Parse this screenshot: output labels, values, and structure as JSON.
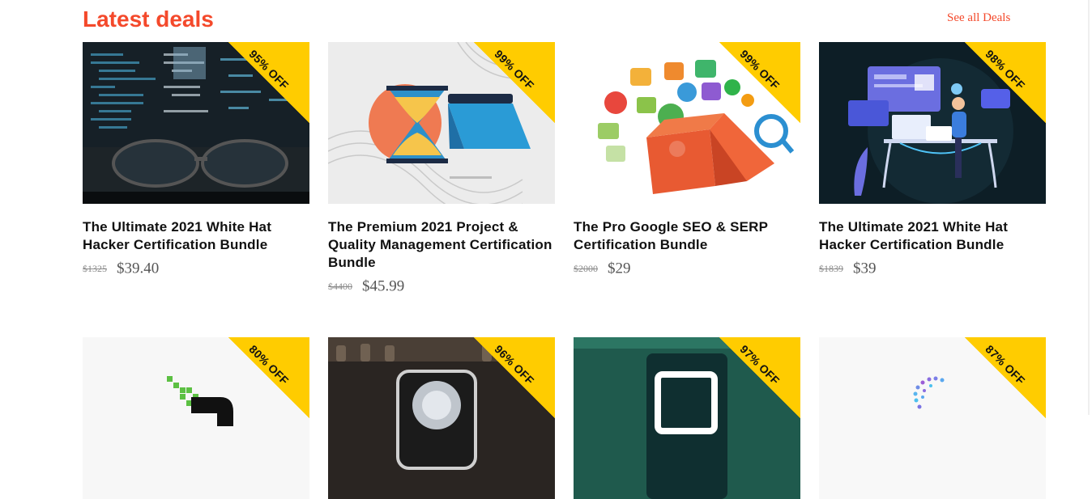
{
  "section": {
    "title": "Latest deals",
    "see_all_label": "See all Deals"
  },
  "colors": {
    "accent": "#f4492b",
    "ribbon": "#ffcc00"
  },
  "deals": [
    {
      "discount": "95% OFF",
      "title": "The Ultimate 2021 White Hat Hacker Certification Bundle",
      "old_price": "$1325",
      "price": "$39.40"
    },
    {
      "discount": "99% OFF",
      "title": "The Premium 2021 Project & Quality Management Certification Bundle",
      "old_price": "$4400",
      "price": "$45.99"
    },
    {
      "discount": "99% OFF",
      "title": "The Pro Google SEO & SERP Certification Bundle",
      "old_price": "$2000",
      "price": "$29"
    },
    {
      "discount": "98% OFF",
      "title": "The Ultimate 2021 White Hat Hacker Certification Bundle",
      "old_price": "$1839",
      "price": "$39"
    },
    {
      "discount": "80% OFF"
    },
    {
      "discount": "96% OFF"
    },
    {
      "discount": "97% OFF"
    },
    {
      "discount": "87% OFF"
    }
  ]
}
